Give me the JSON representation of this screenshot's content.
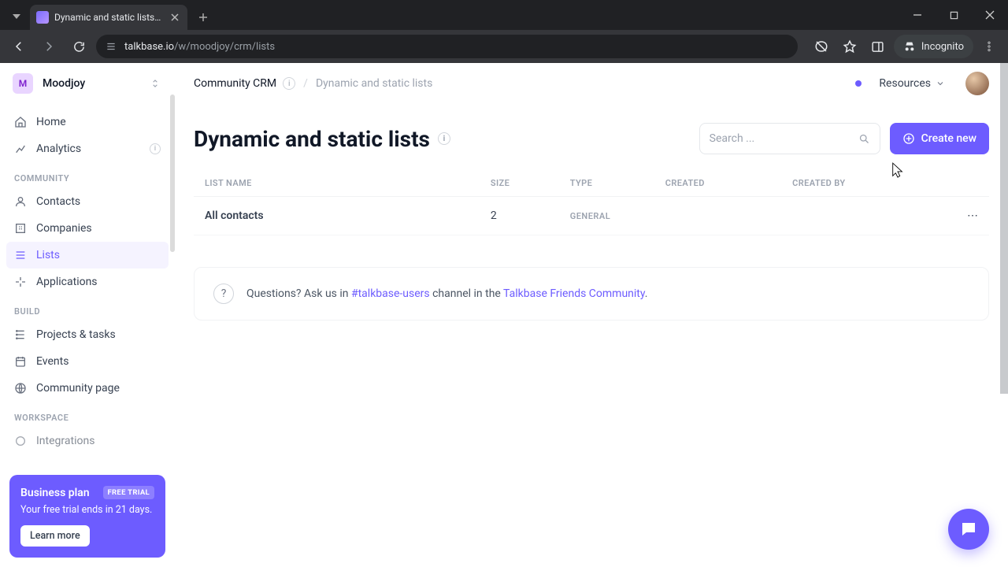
{
  "browser": {
    "tab_title": "Dynamic and static lists | Talkb…",
    "url_host": "talkbase.io",
    "url_path": "/w/moodjoy/crm/lists",
    "incognito_label": "Incognito"
  },
  "workspace": {
    "initial": "M",
    "name": "Moodjoy"
  },
  "sidebar": {
    "items": [
      {
        "label": "Home"
      },
      {
        "label": "Analytics"
      }
    ],
    "community_heading": "Community",
    "community": [
      {
        "label": "Contacts"
      },
      {
        "label": "Companies"
      },
      {
        "label": "Lists"
      },
      {
        "label": "Applications"
      }
    ],
    "build_heading": "Build",
    "build": [
      {
        "label": "Projects & tasks"
      },
      {
        "label": "Events"
      },
      {
        "label": "Community page"
      }
    ],
    "workspace_heading": "Workspace",
    "workspace_items": [
      {
        "label": "Integrations"
      }
    ]
  },
  "promo": {
    "title": "Business plan",
    "badge": "FREE TRIAL",
    "subtitle": "Your free trial ends in 21 days.",
    "cta": "Learn more"
  },
  "breadcrumb": {
    "root": "Community CRM",
    "leaf": "Dynamic and static lists"
  },
  "topbar": {
    "resources_label": "Resources"
  },
  "page": {
    "title": "Dynamic and static lists",
    "search_placeholder": "Search ...",
    "create_label": "Create new"
  },
  "table": {
    "headers": {
      "name": "LIST NAME",
      "size": "SIZE",
      "type": "TYPE",
      "created": "CREATED",
      "created_by": "CREATED BY"
    },
    "rows": [
      {
        "name": "All contacts",
        "size": "2",
        "type": "GENERAL",
        "created": "",
        "created_by": ""
      }
    ]
  },
  "help": {
    "prefix": "Questions? Ask us in ",
    "channel": "#talkbase-users",
    "mid": " channel in the ",
    "link": "Talkbase Friends Community",
    "suffix": "."
  }
}
